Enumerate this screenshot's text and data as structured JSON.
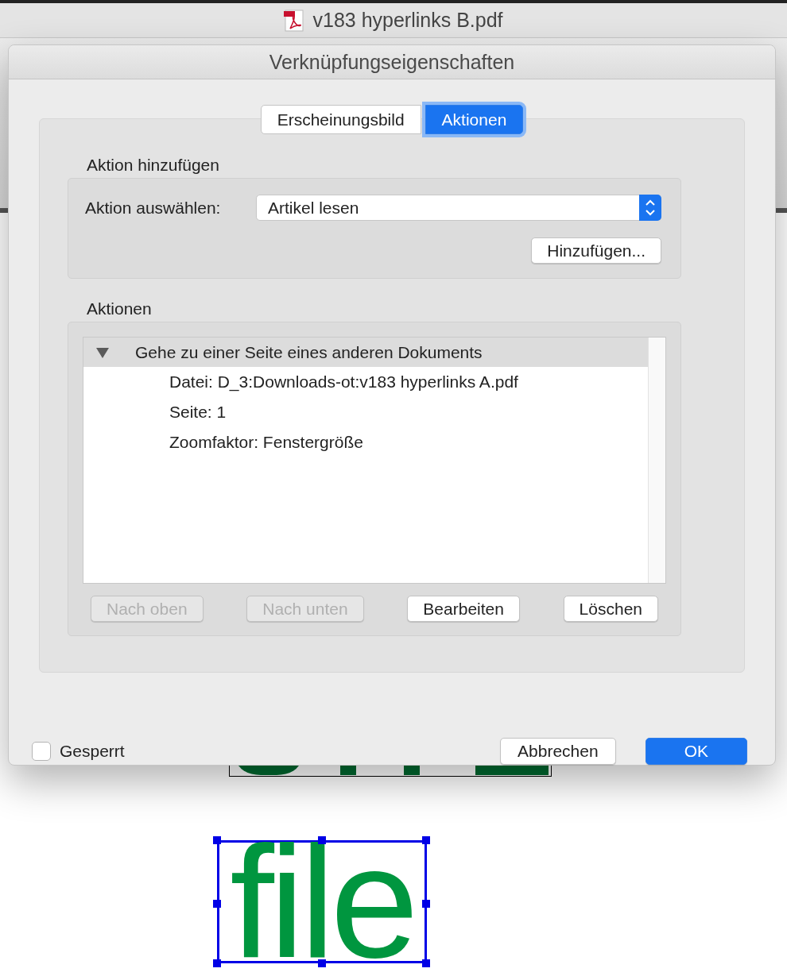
{
  "document_title": "v183 hyperlinks B.pdf",
  "dialog": {
    "title": "Verknüpfungseigenschaften",
    "tabs": [
      {
        "label": "Erscheinungsbild",
        "selected": false
      },
      {
        "label": "Aktionen",
        "selected": true
      }
    ],
    "add_action": {
      "heading": "Aktion hinzufügen",
      "select_label": "Aktion auswählen:",
      "select_value": "Artikel lesen",
      "add_button": "Hinzufügen..."
    },
    "actions": {
      "heading": "Aktionen",
      "tree": [
        {
          "label": "Gehe zu einer Seite eines anderen Dokuments",
          "expanded": true,
          "selected": true,
          "children": [
            {
              "label": "Datei: D_3:Downloads-ot:v183 hyperlinks A.pdf",
              "selected": false
            },
            {
              "label": "Seite: 1",
              "selected": false
            },
            {
              "label": "Zoomfaktor: Fenstergröße",
              "selected": false
            }
          ]
        }
      ],
      "buttons": [
        {
          "label": "Nach oben",
          "disabled": true
        },
        {
          "label": "Nach unten",
          "disabled": true
        },
        {
          "label": "Bearbeiten",
          "disabled": false
        },
        {
          "label": "Löschen",
          "disabled": false
        }
      ]
    },
    "locked": {
      "label": "Gesperrt",
      "checked": false
    },
    "buttons": [
      {
        "label": "Abbrechen",
        "default": false
      },
      {
        "label": "OK",
        "default": true
      }
    ]
  },
  "page": {
    "link_text": "file"
  }
}
